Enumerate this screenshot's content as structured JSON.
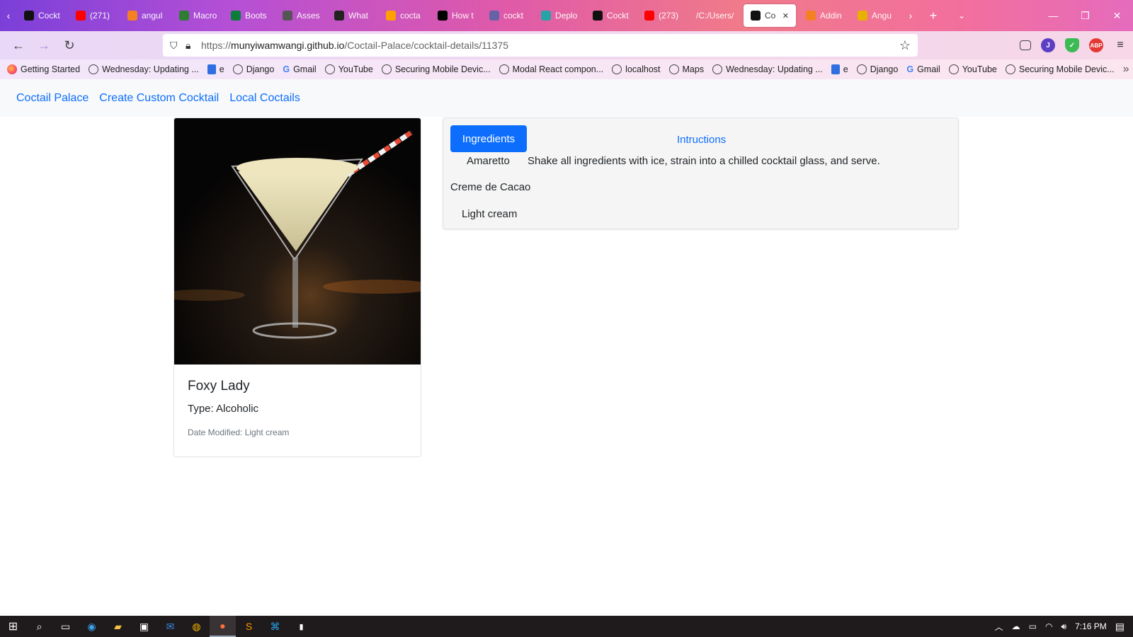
{
  "browser": {
    "tabs": [
      {
        "label": "Cockt",
        "icon": "angular-icon",
        "color": "#111111"
      },
      {
        "label": "(271)",
        "icon": "youtube-icon",
        "color": "#ff0000"
      },
      {
        "label": "angul",
        "icon": "stackoverflow-icon",
        "color": "#f48024"
      },
      {
        "label": "Macro",
        "icon": "macro-icon",
        "color": "#2e7d32"
      },
      {
        "label": "Boots",
        "icon": "w3-icon",
        "color": "#0a7d3a"
      },
      {
        "label": "Asses",
        "icon": "gl-icon",
        "color": "#555555"
      },
      {
        "label": "What",
        "icon": "feather-icon",
        "color": "#222222"
      },
      {
        "label": "cocta",
        "icon": "firebase-icon",
        "color": "#ffa000"
      },
      {
        "label": "How t",
        "icon": "dev-icon",
        "color": "#000000"
      },
      {
        "label": "cockt",
        "icon": "heroku-icon",
        "color": "#6762a6"
      },
      {
        "label": "Deplo",
        "icon": "netlify-icon",
        "color": "#25a3a6"
      },
      {
        "label": "Cockt",
        "icon": "angular-icon",
        "color": "#111111"
      },
      {
        "label": "(273)",
        "icon": "youtube-icon",
        "color": "#ff0000"
      },
      {
        "label": "/C:/Users/",
        "icon": "",
        "color": ""
      },
      {
        "label": "Co",
        "icon": "angular-icon",
        "color": "#111111",
        "active": true
      },
      {
        "label": "Addin",
        "icon": "stackoverflow-icon",
        "color": "#f48024"
      },
      {
        "label": "Angu",
        "icon": "tek-icon",
        "color": "#e8b000"
      }
    ],
    "url_scheme": "https://",
    "url_host": "munyiwamwangi.github.io",
    "url_path": "/Coctail-Palace/cocktail-details/11375"
  },
  "bookmarks": [
    {
      "label": "Getting Started",
      "type": "firefox"
    },
    {
      "label": "Wednesday: Updating ...",
      "type": "globe"
    },
    {
      "label": "e",
      "type": "doc"
    },
    {
      "label": "Django",
      "type": "globe"
    },
    {
      "label": "Gmail",
      "type": "google"
    },
    {
      "label": "YouTube",
      "type": "globe"
    },
    {
      "label": "Securing Mobile Devic...",
      "type": "globe"
    },
    {
      "label": "Modal React compon...",
      "type": "globe"
    },
    {
      "label": "localhost",
      "type": "globe"
    },
    {
      "label": "Maps",
      "type": "globe"
    },
    {
      "label": "Wednesday: Updating ...",
      "type": "globe"
    },
    {
      "label": "e",
      "type": "doc"
    },
    {
      "label": "Django",
      "type": "globe"
    },
    {
      "label": "Gmail",
      "type": "google"
    },
    {
      "label": "YouTube",
      "type": "globe"
    },
    {
      "label": "Securing Mobile Devic...",
      "type": "globe"
    }
  ],
  "app_nav": {
    "brand": "Coctail Palace",
    "create": "Create Custom Cocktail",
    "local": "Local Coctails"
  },
  "drink": {
    "name": "Foxy Lady",
    "type": "Type: Alcoholic",
    "modified": "Date Modified: Light cream"
  },
  "details": {
    "tab_ingredients": "Ingredients",
    "tab_instructions": "Intructions",
    "ingredients": [
      "Amaretto",
      "Creme de Cacao",
      "Light cream"
    ],
    "instructions": "Shake all ingredients with ice, strain into a chilled cocktail glass, and serve."
  },
  "taskbar": {
    "time": "7:16 PM"
  },
  "colors": {
    "link": "#0d6efd",
    "button": "#0d6efd",
    "panel_bg": "#f5f5f5"
  }
}
